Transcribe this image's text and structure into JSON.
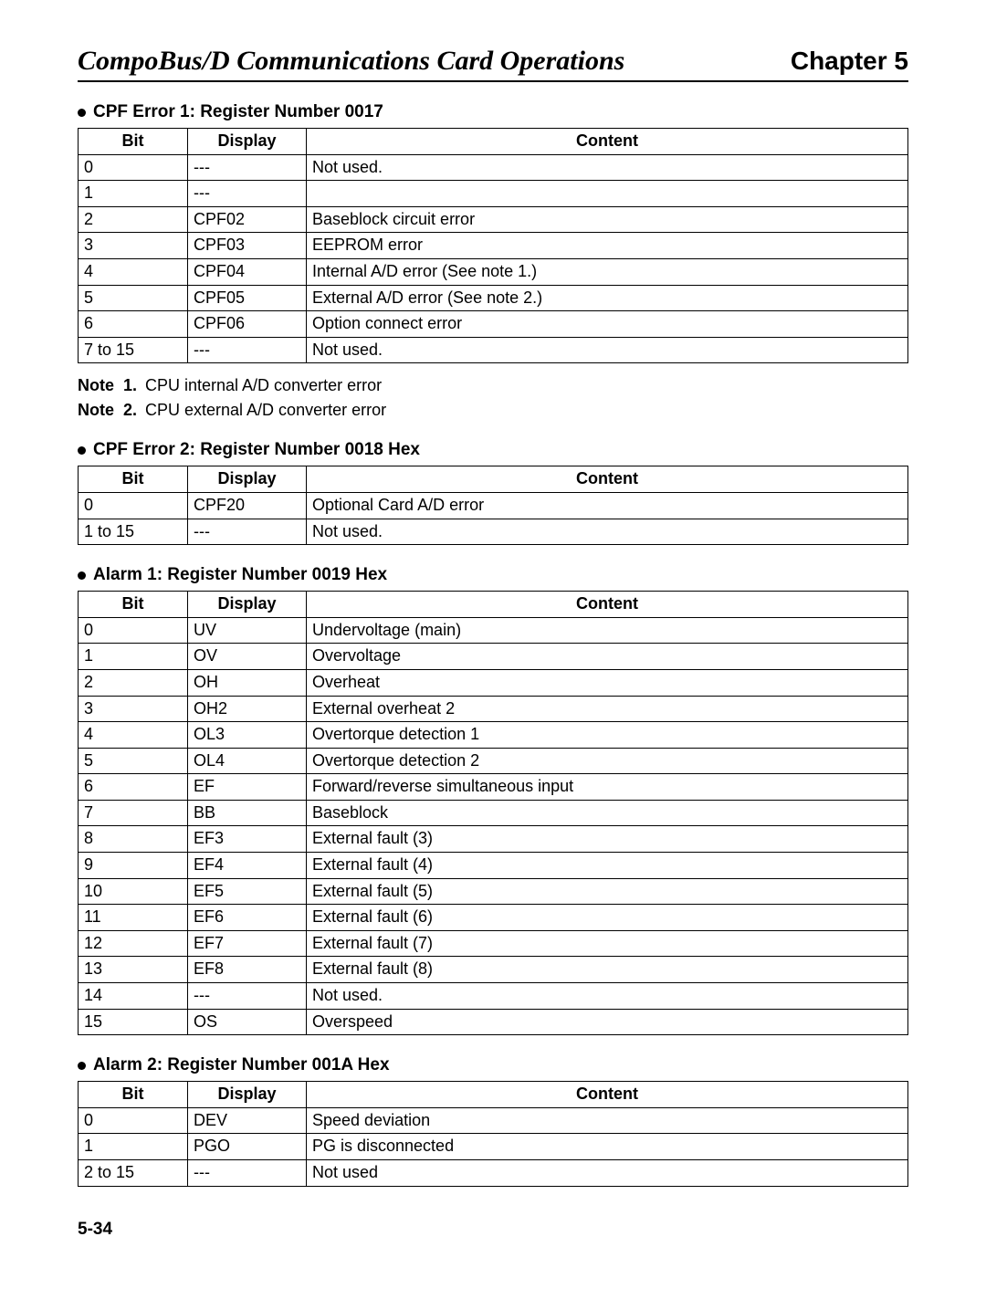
{
  "header": {
    "title": "CompoBus/D Communications Card Operations",
    "chapter": "Chapter 5"
  },
  "sections": [
    {
      "heading": "CPF Error 1: Register Number 0017",
      "columns": [
        "Bit",
        "Display",
        "Content"
      ],
      "rows": [
        {
          "bit": "0",
          "display": "---",
          "content": "Not used."
        },
        {
          "bit": "1",
          "display": "---",
          "content": ""
        },
        {
          "bit": "2",
          "display": "CPF02",
          "content": "Baseblock circuit error"
        },
        {
          "bit": "3",
          "display": "CPF03",
          "content": "EEPROM error"
        },
        {
          "bit": "4",
          "display": "CPF04",
          "content": "Internal A/D error (See note 1.)"
        },
        {
          "bit": "5",
          "display": "CPF05",
          "content": "External A/D error (See note 2.)"
        },
        {
          "bit": "6",
          "display": "CPF06",
          "content": "Option connect error"
        },
        {
          "bit": "7 to 15",
          "display": "---",
          "content": "Not used."
        }
      ],
      "notes": [
        {
          "label": "Note",
          "num": "1.",
          "text": "CPU internal A/D converter error"
        },
        {
          "label": "Note",
          "num": "2.",
          "text": "CPU external A/D converter error"
        }
      ]
    },
    {
      "heading": "CPF Error 2: Register Number 0018 Hex",
      "columns": [
        "Bit",
        "Display",
        "Content"
      ],
      "rows": [
        {
          "bit": "0",
          "display": "CPF20",
          "content": "Optional Card A/D error"
        },
        {
          "bit": "1 to 15",
          "display": "---",
          "content": "Not used."
        }
      ]
    },
    {
      "heading": "Alarm 1: Register Number 0019 Hex",
      "columns": [
        "Bit",
        "Display",
        "Content"
      ],
      "rows": [
        {
          "bit": "0",
          "display": "UV",
          "content": "Undervoltage (main)"
        },
        {
          "bit": "1",
          "display": "OV",
          "content": "Overvoltage"
        },
        {
          "bit": "2",
          "display": "OH",
          "content": "Overheat"
        },
        {
          "bit": "3",
          "display": "OH2",
          "content": "External overheat 2"
        },
        {
          "bit": "4",
          "display": "OL3",
          "content": "Overtorque detection 1"
        },
        {
          "bit": "5",
          "display": "OL4",
          "content": "Overtorque detection 2"
        },
        {
          "bit": "6",
          "display": "EF",
          "content": "Forward/reverse simultaneous input"
        },
        {
          "bit": "7",
          "display": "BB",
          "content": "Baseblock"
        },
        {
          "bit": "8",
          "display": "EF3",
          "content": "External fault (3)"
        },
        {
          "bit": "9",
          "display": "EF4",
          "content": "External fault (4)"
        },
        {
          "bit": "10",
          "display": "EF5",
          "content": "External fault (5)"
        },
        {
          "bit": "11",
          "display": "EF6",
          "content": "External fault (6)"
        },
        {
          "bit": "12",
          "display": "EF7",
          "content": "External fault (7)"
        },
        {
          "bit": "13",
          "display": "EF8",
          "content": "External fault (8)"
        },
        {
          "bit": "14",
          "display": "---",
          "content": "Not used."
        },
        {
          "bit": "15",
          "display": "OS",
          "content": "Overspeed"
        }
      ]
    },
    {
      "heading": "Alarm 2: Register Number 001A Hex",
      "columns": [
        "Bit",
        "Display",
        "Content"
      ],
      "rows": [
        {
          "bit": "0",
          "display": "DEV",
          "content": "Speed deviation"
        },
        {
          "bit": "1",
          "display": "PGO",
          "content": "PG is disconnected"
        },
        {
          "bit": "2 to 15",
          "display": "---",
          "content": "Not used"
        }
      ]
    }
  ],
  "pageNumber": "5-34"
}
